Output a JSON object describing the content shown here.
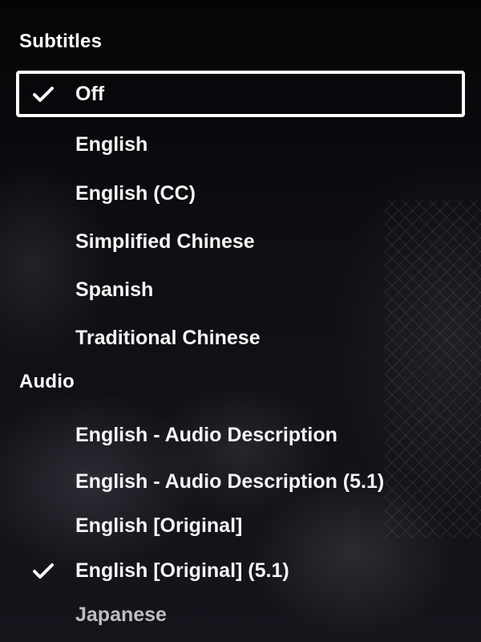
{
  "subtitles": {
    "heading": "Subtitles",
    "options": [
      {
        "label": "Off",
        "selected": true,
        "focused": true
      },
      {
        "label": "English",
        "selected": false
      },
      {
        "label": "English  (CC)",
        "selected": false
      },
      {
        "label": "Simplified Chinese",
        "selected": false
      },
      {
        "label": "Spanish",
        "selected": false
      },
      {
        "label": "Traditional Chinese",
        "selected": false
      }
    ]
  },
  "audio": {
    "heading": "Audio",
    "options": [
      {
        "label": "English - Audio Description",
        "selected": false
      },
      {
        "label": "English - Audio Description  (5.1)",
        "selected": false
      },
      {
        "label": "English [Original]",
        "selected": false
      },
      {
        "label": "English [Original]  (5.1)",
        "selected": true
      },
      {
        "label": "Japanese",
        "selected": false
      }
    ]
  },
  "icons": {
    "selected_marker": "checkmark-icon"
  },
  "colors": {
    "text": "#ffffff",
    "focus_border": "#ffffff",
    "background": "#0b0b10"
  }
}
